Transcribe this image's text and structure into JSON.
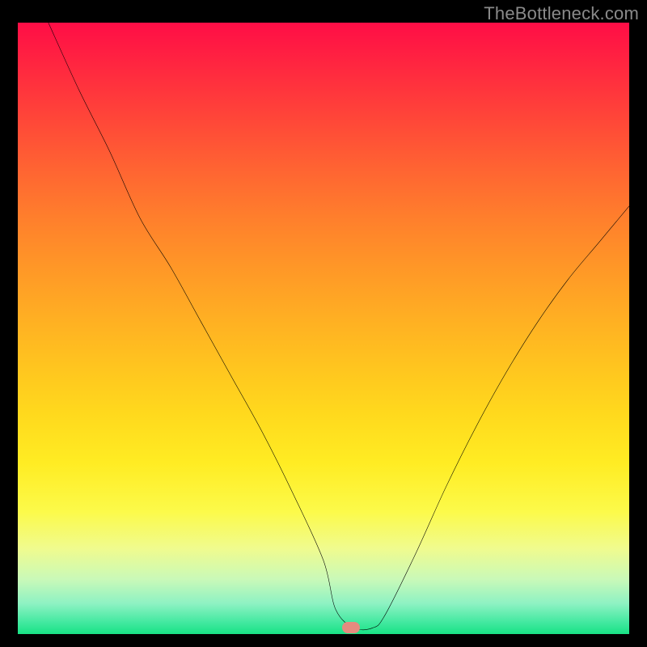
{
  "watermark": "TheBottleneck.com",
  "marker": {
    "x_pct": 54.5,
    "y_pct": 99.0,
    "color": "#e68b7f"
  },
  "chart_data": {
    "type": "line",
    "title": "",
    "xlabel": "",
    "ylabel": "",
    "xlim": [
      0,
      100
    ],
    "ylim": [
      0,
      100
    ],
    "grid": false,
    "legend": false,
    "series": [
      {
        "name": "bottleneck-curve",
        "x": [
          5,
          10,
          15,
          20,
          25,
          30,
          35,
          40,
          45,
          50,
          52,
          55,
          58,
          60,
          65,
          70,
          75,
          80,
          85,
          90,
          95,
          100
        ],
        "y": [
          100,
          89,
          79,
          68,
          60,
          51,
          42,
          33,
          23,
          12,
          4,
          1,
          1,
          3,
          13,
          24,
          34,
          43,
          51,
          58,
          64,
          70
        ]
      }
    ],
    "marker_point": {
      "x": 54.5,
      "y": 1
    },
    "gradient_stops": [
      {
        "pct": 0,
        "color": "#ff0d46"
      },
      {
        "pct": 16,
        "color": "#ff4738"
      },
      {
        "pct": 32,
        "color": "#ff7f2c"
      },
      {
        "pct": 48,
        "color": "#ffae23"
      },
      {
        "pct": 64,
        "color": "#ffd91d"
      },
      {
        "pct": 80,
        "color": "#fcfa4a"
      },
      {
        "pct": 91,
        "color": "#caf9b8"
      },
      {
        "pct": 100,
        "color": "#18e285"
      }
    ]
  }
}
